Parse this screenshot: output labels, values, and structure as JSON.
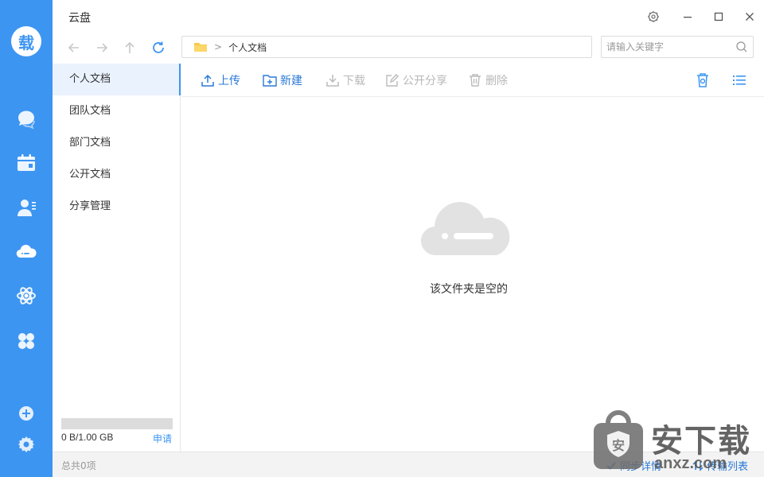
{
  "app": {
    "logo_char": "载",
    "title": "云盘"
  },
  "nav": {
    "crumb": "个人文档",
    "search_placeholder": "请输入关键字"
  },
  "sidebar": {
    "items": [
      {
        "label": "个人文档",
        "active": true
      },
      {
        "label": "团队文档",
        "active": false
      },
      {
        "label": "部门文档",
        "active": false
      },
      {
        "label": "公开文档",
        "active": false
      },
      {
        "label": "分享管理",
        "active": false
      }
    ],
    "quota": {
      "text": "0 B/1.00 GB",
      "used_fraction": 0,
      "apply_label": "申请"
    }
  },
  "toolbar": {
    "upload": "上传",
    "new": "新建",
    "download": "下载",
    "share": "公开分享",
    "delete": "删除"
  },
  "main": {
    "empty_text": "该文件夹是空的"
  },
  "status": {
    "count": "总共0项",
    "sync_details": "同步详情",
    "transfer_list": "传输列表"
  },
  "watermark": {
    "title": "安下载",
    "sub": "anxz.com",
    "badge": "安"
  },
  "colors": {
    "accent": "#3d95f2",
    "link": "#2b79d6",
    "disabled": "#b8b8b8"
  }
}
